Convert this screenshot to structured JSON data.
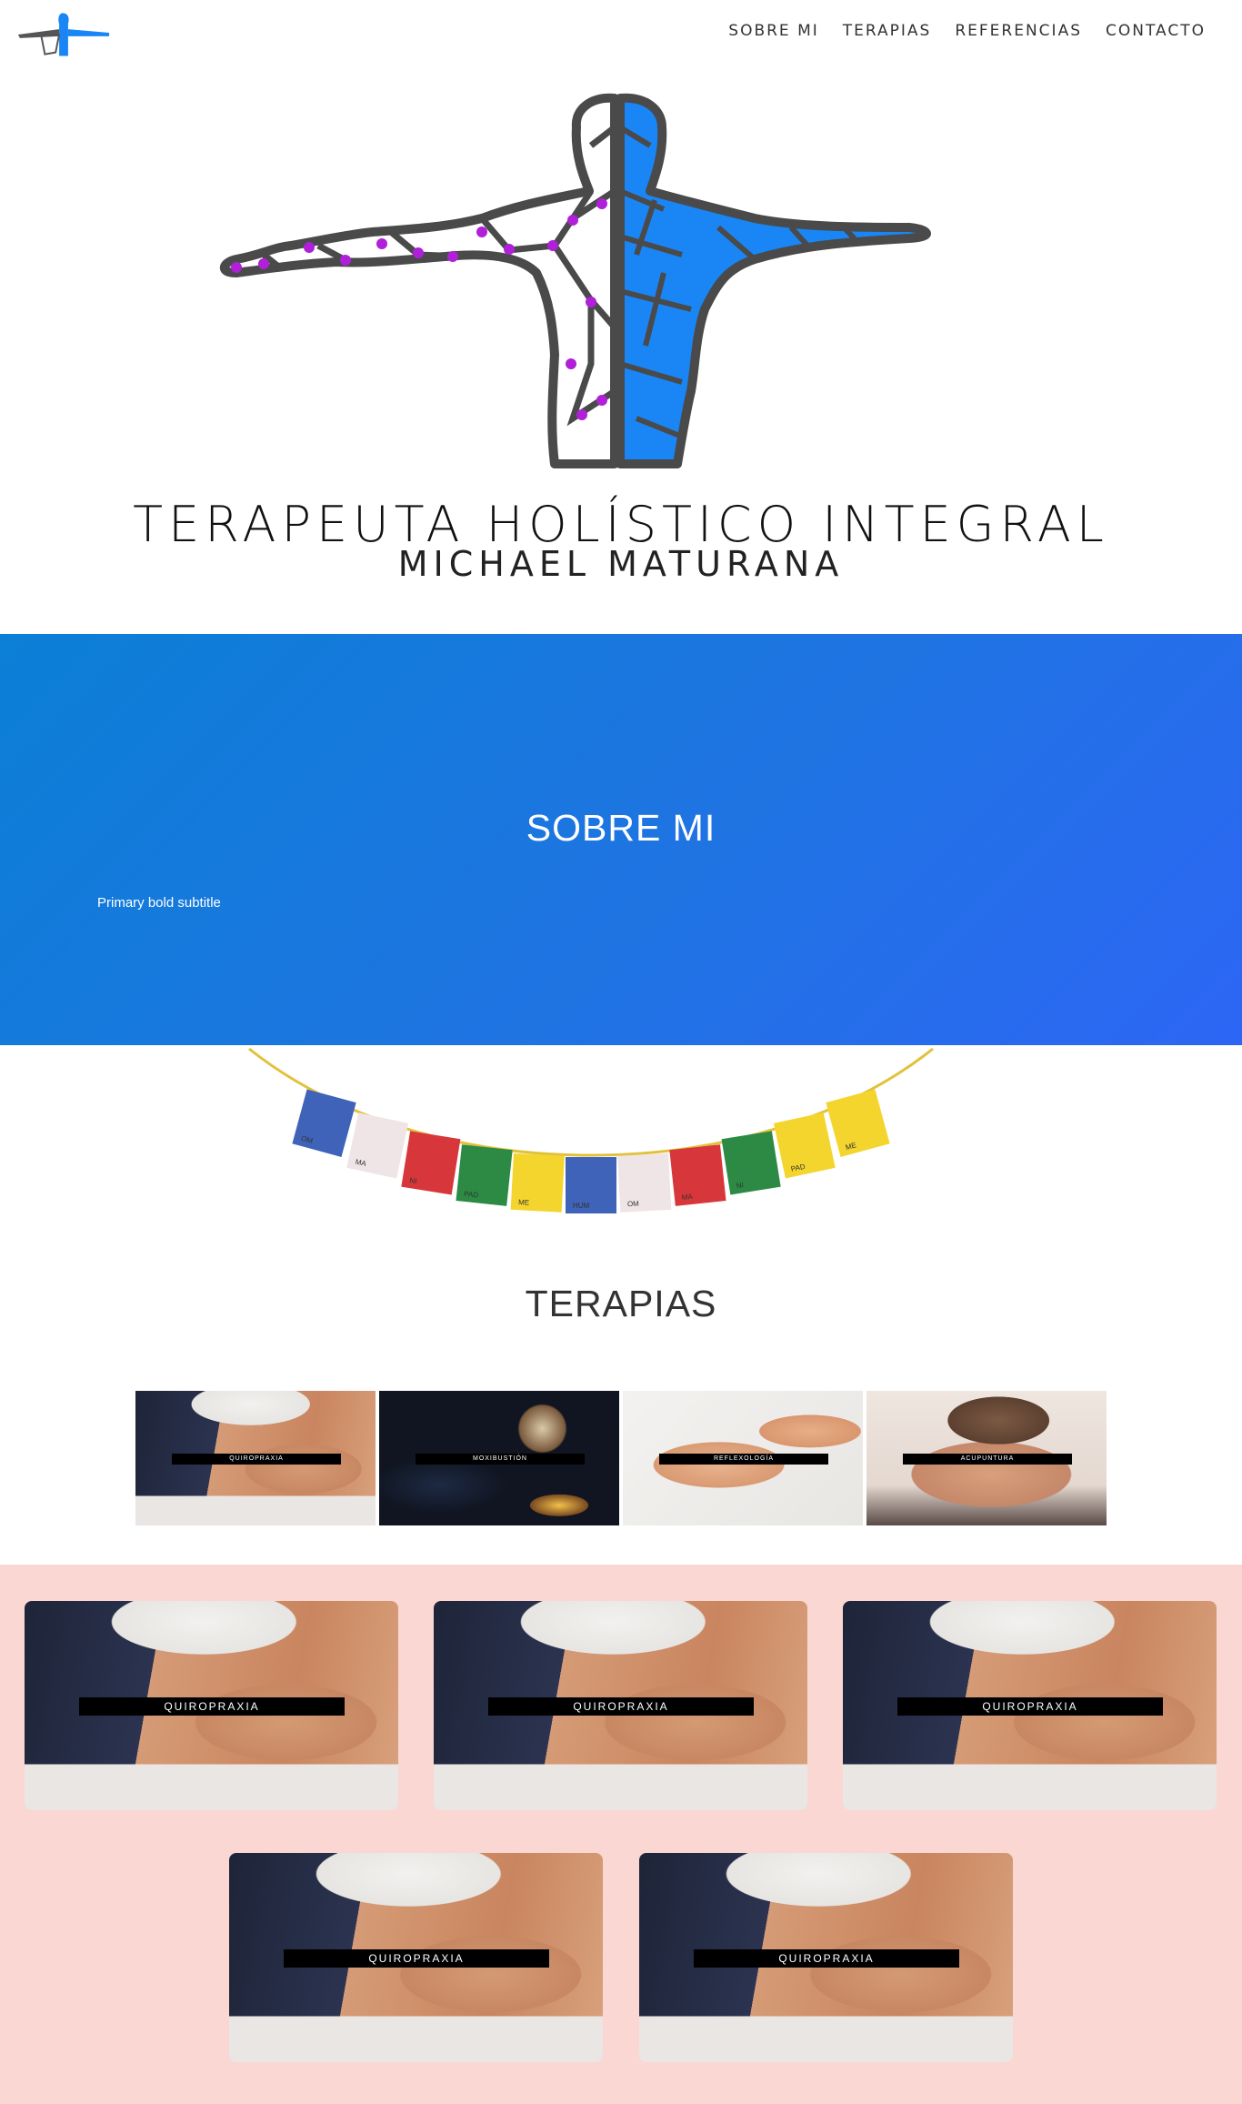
{
  "nav": {
    "links": [
      "SOBRE MI",
      "TERAPIAS",
      "REFERENCIAS",
      "CONTACTO"
    ]
  },
  "hero": {
    "title": "TERAPEUTA HOLÍSTICO INTEGRAL",
    "subtitle": "MICHAEL MATURANA"
  },
  "about": {
    "title": "SOBRE MI",
    "subtitle": "Primary bold subtitle"
  },
  "flags": [
    "OM",
    "MA",
    "NI",
    "PAD",
    "ME",
    "HUM",
    "OM",
    "MA",
    "NI",
    "PAD",
    "ME"
  ],
  "therapies": {
    "title": "TERAPIAS",
    "thumbnails": [
      {
        "label": "QUIROPRAXIA"
      },
      {
        "label": "MOXIBUSTIÓN"
      },
      {
        "label": "REFLEXOLOGÍA"
      },
      {
        "label": "ACUPUNTURA"
      }
    ]
  },
  "cards": [
    {
      "label": "QUIROPRAXIA"
    },
    {
      "label": "QUIROPRAXIA"
    },
    {
      "label": "QUIROPRAXIA"
    },
    {
      "label": "QUIROPRAXIA"
    },
    {
      "label": "QUIROPRAXIA"
    }
  ],
  "colors": {
    "accent_blue": "#1a86f5",
    "band_gradient_start": "#0b7fd6",
    "band_gradient_end": "#2d66f5",
    "pink_background": "#fad7d2",
    "figure_gray": "#4a4a4a",
    "joint_purple": "#b020d8"
  }
}
